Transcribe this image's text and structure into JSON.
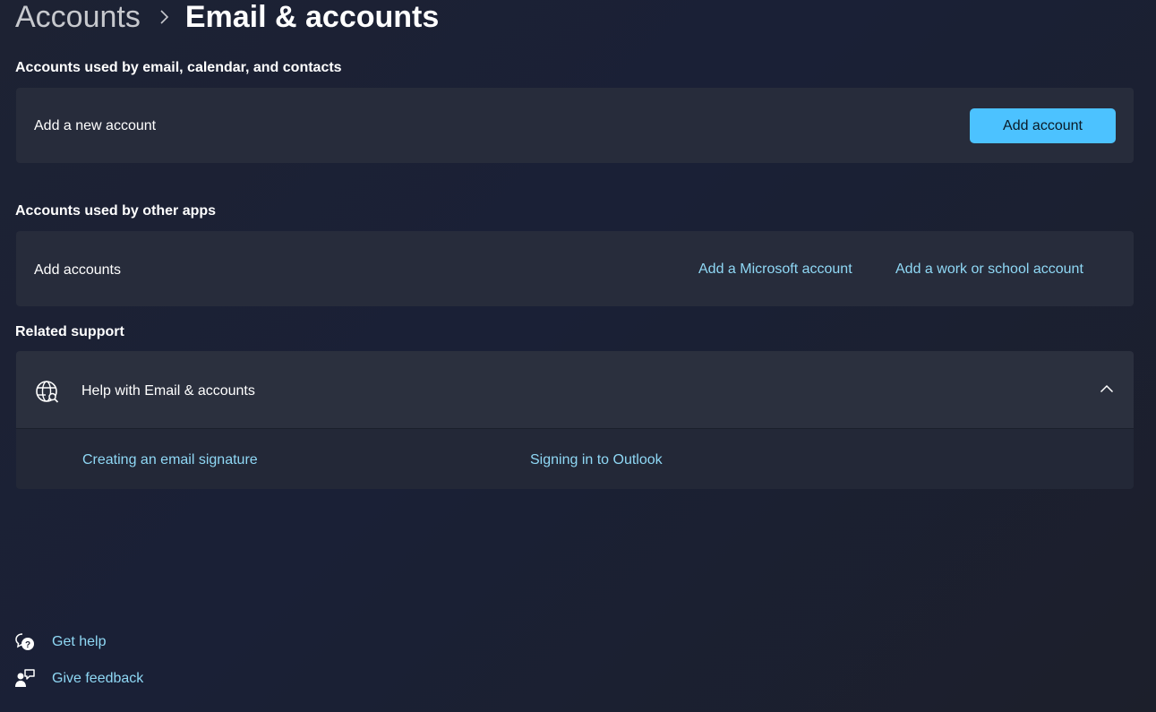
{
  "breadcrumb": {
    "parent": "Accounts",
    "separator_icon": "chevron-right-icon",
    "current": "Email & accounts"
  },
  "email_section": {
    "title": "Accounts used by email, calendar, and contacts",
    "row_label": "Add a new account",
    "button_label": "Add account"
  },
  "other_apps_section": {
    "title": "Accounts used by other apps",
    "row_label": "Add accounts",
    "links": [
      "Add a Microsoft account",
      "Add a work or school account"
    ]
  },
  "related_support": {
    "title": "Related support",
    "help_title": "Help with Email & accounts",
    "help_icon": "globe-icon",
    "expanded": true,
    "links": [
      "Creating an email signature",
      "Signing in to Outlook"
    ]
  },
  "footer": {
    "get_help": "Get help",
    "give_feedback": "Give feedback"
  },
  "colors": {
    "accent": "#4cc2ff",
    "link": "#8fd8f5",
    "card": "#272c3b"
  }
}
